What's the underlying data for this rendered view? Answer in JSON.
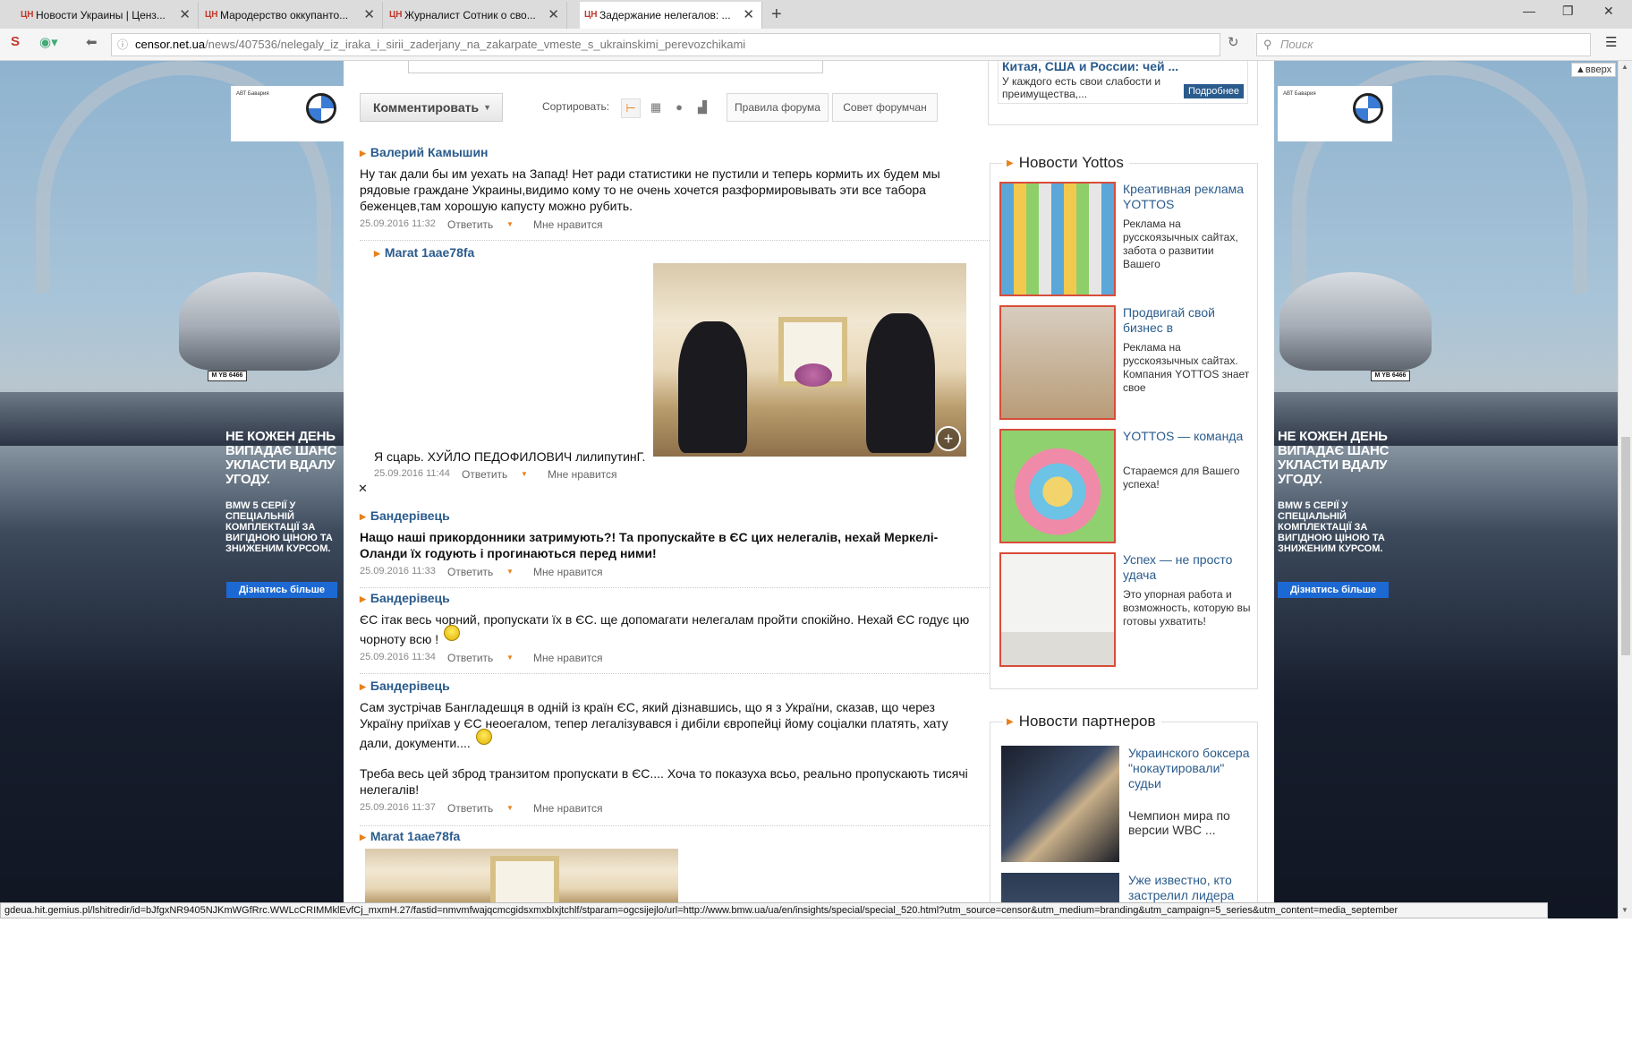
{
  "browser": {
    "tabs": [
      {
        "label": "Новости Украины | Ценз...",
        "favicon": "ЦН"
      },
      {
        "label": "Мародерство оккупанто...",
        "favicon": "ЦН"
      },
      {
        "label": "Журналист Сотник о сво...",
        "favicon": "ЦН"
      },
      {
        "label": "Задержание нелегалов: ...",
        "favicon": "ЦН"
      }
    ],
    "url_host": "censor.net.ua",
    "url_path": "/news/407536/nelegaly_iz_iraka_i_sirii_zaderjany_na_zakarpate_vmeste_s_ukrainskimi_perevozchikami",
    "search_placeholder": "Поиск",
    "status_url": "gdeua.hit.gemius.pl/lshitredir/id=bJfgxNR9405NJKmWGfRrc.WWLcCRIMMklEvfCj_mxmH.27/fastid=nmvmfwajqcmcgidsxmxblxjtchlf/stparam=ogcsijejlo/url=http://www.bmw.ua/ua/en/insights/special/special_520.html?utm_source=censor&utm_medium=branding&utm_campaign=5_series&utm_content=media_september"
  },
  "banner": {
    "dealer": "АВТ Бавария",
    "plate": "M YB 6466",
    "headline": "НЕ КОЖЕН ДЕНЬ ВИПАДАЄ ШАНС УКЛАСТИ ВДАЛУ УГОДУ.",
    "sub": "BMW 5 СЕРІЇ У СПЕЦІАЛЬНІЙ КОМПЛЕКТАЦІЇ ЗА ВИГІДНОЮ ЦІНОЮ ТА ЗНИЖЕНИМ КУРСОМ.",
    "button": "Дізнатись більше"
  },
  "toolbar": {
    "comment_button": "Комментировать",
    "sort_label": "Сортировать:",
    "rules": "Правила форума",
    "advice": "Совет форумчан"
  },
  "back_to_top": "▲вверх",
  "comments": [
    {
      "author": "Валерий Камышин",
      "text": "Ну так дали бы им уехать на Запад! Нет ради статистики не пустили и теперь кормить их будем мы рядовые граждане Украины,видимо кому то не очень хочется разформировывать эти все табора беженцев,там хорошую капусту можно рубить.",
      "date": "25.09.2016 11:32",
      "reply": "Ответить",
      "like": "Мне нравится"
    },
    {
      "author": "Marat 1aae78fa",
      "text": "Я сцарь. ХУЙЛО ПЕДОФИЛОВИЧ лилипутинГ.",
      "date": "25.09.2016 11:44",
      "reply": "Ответить",
      "like": "Мне нравится"
    },
    {
      "author": "Бандерівець",
      "text": "Нащо наші прикордонники затримують?! Та пропускайте в ЄС цих нелегалів, нехай Меркелі-Оланди їх годують і прогинаються перед ними!",
      "date": "25.09.2016 11:33",
      "reply": "Ответить",
      "like": "Мне нравится"
    },
    {
      "author": "Бандерівець",
      "text": "ЄС ітак весь чорний, пропускати їх в ЄС. ще допомагати нелегалам пройти спокійно. Нехай ЄС годує цю чорноту всю !",
      "date": "25.09.2016 11:34",
      "reply": "Ответить",
      "like": "Мне нравится"
    },
    {
      "author": "Бандерівець",
      "text": "Сам зустрічав Бангладешця в одній із країн ЄС, який дізнавшись, що я з України, сказав, що через Україну приїхав у ЄС неоегалом, тепер легалізувався і дибіли європейці йому соціалки платять, хату дали, документи....",
      "text2": "Треба весь цей зброд транзитом пропускати в ЄС.... Хоча то показуха всьо, реально пропускають тисячі нелегалів!",
      "date": "25.09.2016 11:37",
      "reply": "Ответить",
      "like": "Мне нравится"
    },
    {
      "author": "Marat 1aae78fa"
    }
  ],
  "promo_top": {
    "title": "Китая, США и России: чей ...",
    "desc": "У каждого есть свои слабости и преимущества,...",
    "more": "Подробнее"
  },
  "yottos": {
    "title": "Новости Yottos",
    "items": [
      {
        "title": "Креативная реклама YOTTOS",
        "desc": "Реклама на русскоязычных сайтах, забота о развитии Вашего"
      },
      {
        "title": "Продвигай свой бизнес в",
        "desc": "Реклама на русскоязычных сайтах. Компания YOTTOS знает свое"
      },
      {
        "title": "YOTTOS — команда",
        "desc": "Стараемся для Вашего успеха!"
      },
      {
        "title": "Успех — не просто удача",
        "desc": "Это упорная работа и возможность, которую вы готовы ухватить!"
      }
    ]
  },
  "partners": {
    "title": "Новости партнеров",
    "items": [
      {
        "title": "Украинского боксера \"нокаутировали\" судьи",
        "desc": "Чемпион мира по версии WBC ..."
      },
      {
        "title": "Уже известно, кто застрелил лидера",
        "desc": ""
      }
    ]
  },
  "colors": {
    "link": "#2a5b8c",
    "accent": "#e8811b",
    "bmw_blue": "#1c69d4"
  }
}
